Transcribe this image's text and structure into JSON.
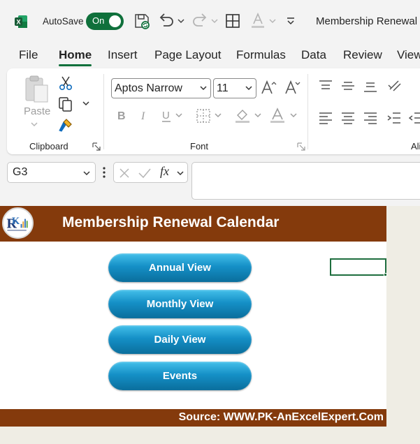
{
  "titlebar": {
    "autosave_label": "AutoSave",
    "autosave_state": "On",
    "document_title": "Membership Renewal C",
    "accent_color": "#0f703b"
  },
  "tabs": [
    {
      "label": "File"
    },
    {
      "label": "Home",
      "active": true
    },
    {
      "label": "Insert"
    },
    {
      "label": "Page Layout"
    },
    {
      "label": "Formulas"
    },
    {
      "label": "Data"
    },
    {
      "label": "Review"
    },
    {
      "label": "View"
    }
  ],
  "ribbon": {
    "clipboard": {
      "label": "Clipboard",
      "paste_label": "Paste"
    },
    "font": {
      "label": "Font",
      "font_name": "Aptos Narrow",
      "font_size": "11"
    },
    "alignment": {
      "label": "Ali"
    }
  },
  "formula_bar": {
    "name_box": "G3",
    "fx_label": "fx",
    "value": ""
  },
  "sheet": {
    "title": "Membership Renewal Calendar",
    "buttons": [
      "Annual View",
      "Monthly View",
      "Daily View",
      "Events"
    ],
    "footer": "Source: WWW.PK-AnExcelExpert.Com",
    "banner_color": "#843a0c",
    "button_color": "#1590c7"
  }
}
